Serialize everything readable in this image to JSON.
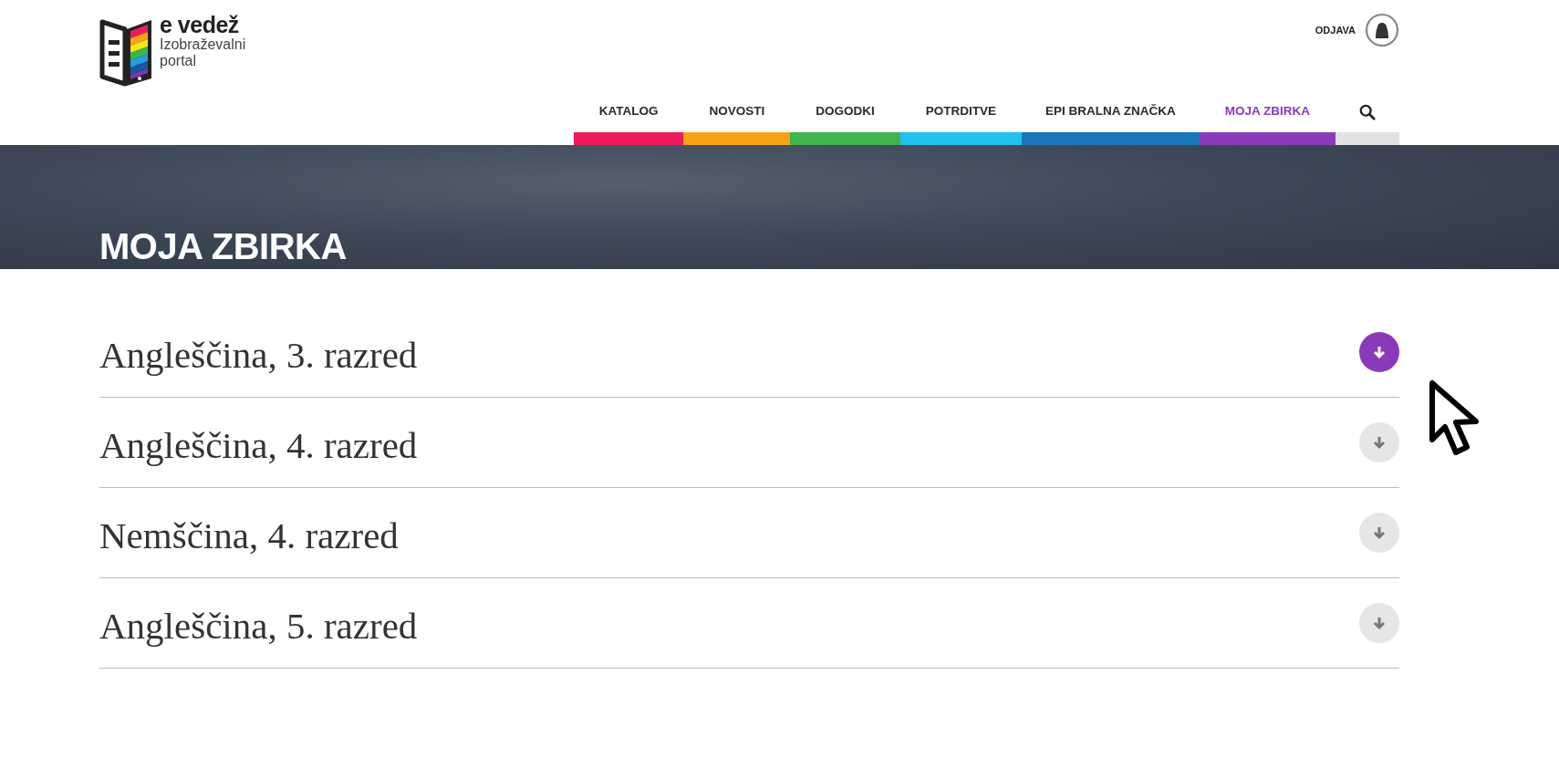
{
  "logo": {
    "name": "e vedež",
    "subtitle": "Izobraževalni portal"
  },
  "user": {
    "logout": "ODJAVA"
  },
  "nav": [
    {
      "label": "KATALOG",
      "color": "#ee1a5e",
      "selected": false
    },
    {
      "label": "NOVOSTI",
      "color": "#f5a414",
      "selected": false
    },
    {
      "label": "DOGODKI",
      "color": "#3db54a",
      "selected": false
    },
    {
      "label": "POTRDITVE",
      "color": "#1fc1ee",
      "selected": false
    },
    {
      "label": "EPI BRALNA ZNAČKA",
      "color": "#1a75bb",
      "selected": false
    },
    {
      "label": "MOJA ZBIRKA",
      "color": "#8a3ab9",
      "selected": true
    }
  ],
  "banner": {
    "title": "MOJA ZBIRKA"
  },
  "collections": [
    {
      "title": "Angleščina, 3. razred",
      "hovered": true
    },
    {
      "title": "Angleščina, 4. razred",
      "hovered": false
    },
    {
      "title": "Nemščina, 4. razred",
      "hovered": false
    },
    {
      "title": "Angleščina, 5. razred",
      "hovered": false
    }
  ]
}
